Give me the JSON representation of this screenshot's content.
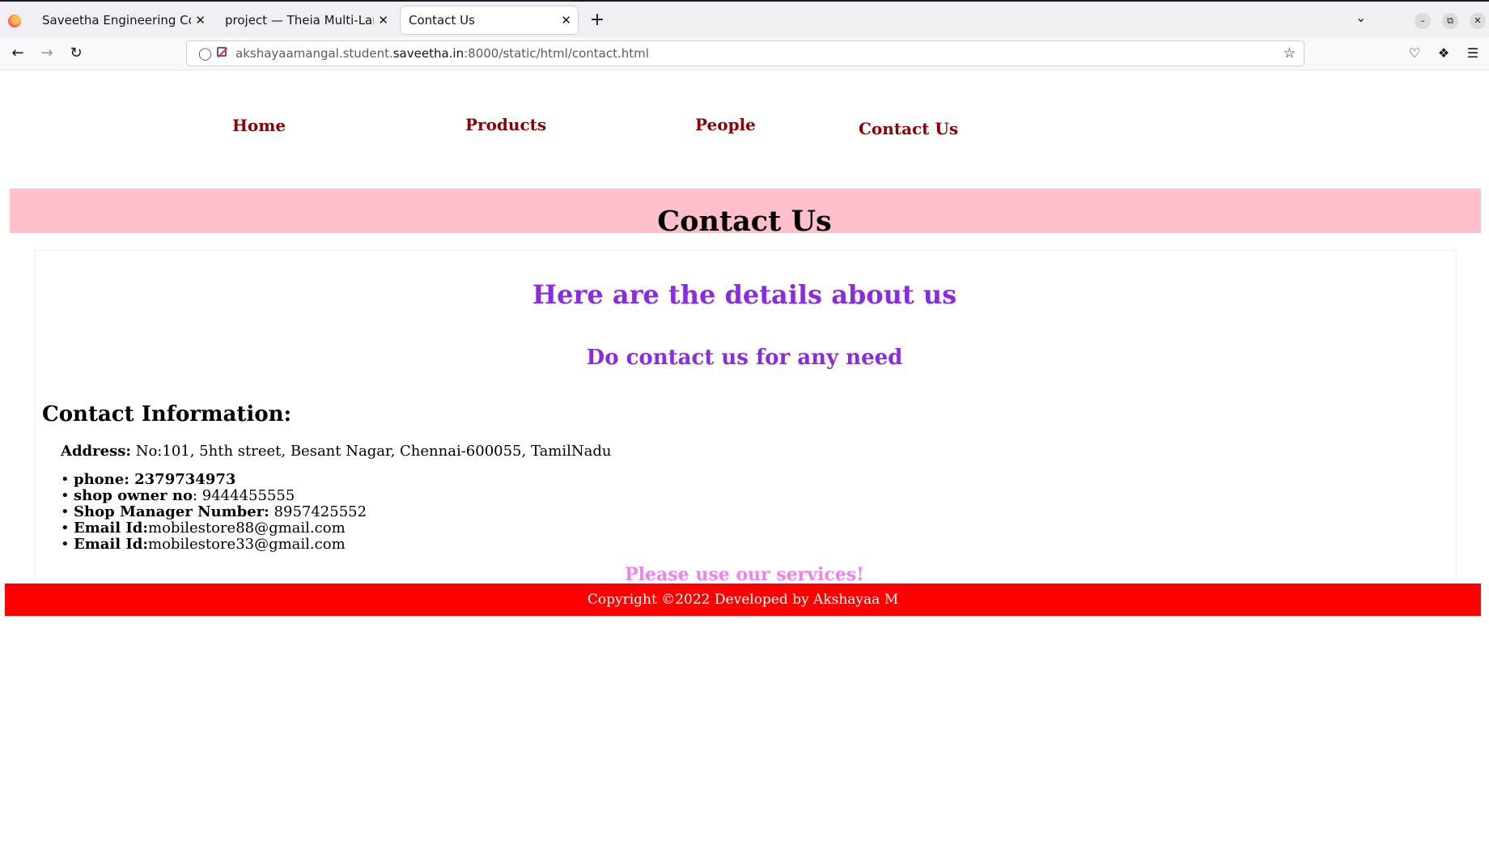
{
  "browser": {
    "tabs": [
      {
        "label": "Saveetha Engineering Colleg"
      },
      {
        "label": "project — Theia Multi-Langu"
      },
      {
        "label": "Contact Us"
      }
    ],
    "url": {
      "prefix": "akshayaamangal.student.",
      "domain": "saveetha.in",
      "suffix": ":8000/static/html/contact.html"
    }
  },
  "nav": {
    "home": "Home",
    "products": "Products",
    "people": "People",
    "contact": "Contact Us"
  },
  "banner": {
    "title": "Contact Us"
  },
  "main": {
    "heading": "Here are the details about us",
    "subheading": "Do contact us for any need",
    "info_title": "Contact Information:",
    "address_label": "Address:",
    "address_value": " No:101, 5hth street, Besant Nagar, Chennai-600055, TamilNadu",
    "contacts": [
      {
        "label": "phone: 2379734973",
        "value": ""
      },
      {
        "label": "shop owner no",
        "value": ": 9444455555"
      },
      {
        "label": "Shop Manager Number:",
        "value": " 8957425552"
      },
      {
        "label": "Email Id:",
        "value": "mobilestore88@gmail.com"
      },
      {
        "label": "Email Id:",
        "value": "mobilestore33@gmail.com"
      }
    ],
    "closing": "Please use our services!"
  },
  "footer": {
    "text": "Copyright ©2022 Developed by Akshayaa M"
  },
  "colors": {
    "nav_link": "#8b0000",
    "banner_bg": "#ffc0cb",
    "heading": "#8a2be2",
    "closing": "#ee82ee",
    "footer_bg": "#ff0000"
  }
}
